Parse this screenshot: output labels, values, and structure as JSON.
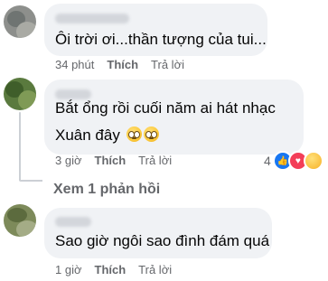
{
  "comments": [
    {
      "text": "Ôi trời ơi...thần tượng của tui...",
      "time": "34 phút",
      "like": "Thích",
      "reply": "Trả lời"
    },
    {
      "text_line1": "Bắt ổng rồi cuối năm ai hát nhạc",
      "text_line2": "Xuân đây",
      "time": "3 giờ",
      "like": "Thích",
      "reply": "Trả lời",
      "reaction_count": "4",
      "reaction_icons": [
        "like-icon",
        "love-icon",
        "haha-icon"
      ],
      "replies_link": "Xem 1 phản hồi"
    },
    {
      "text": "Sao giờ ngôi sao đình đám quá",
      "time": "1 giờ",
      "like": "Thích",
      "reply": "Trả lời"
    }
  ],
  "colors": {
    "bubble": "#f0f2f5",
    "meta_text": "#65676b",
    "like_reaction": "#1877f2",
    "love_reaction": "#f33e58",
    "haha_reaction": "#f7b125"
  }
}
